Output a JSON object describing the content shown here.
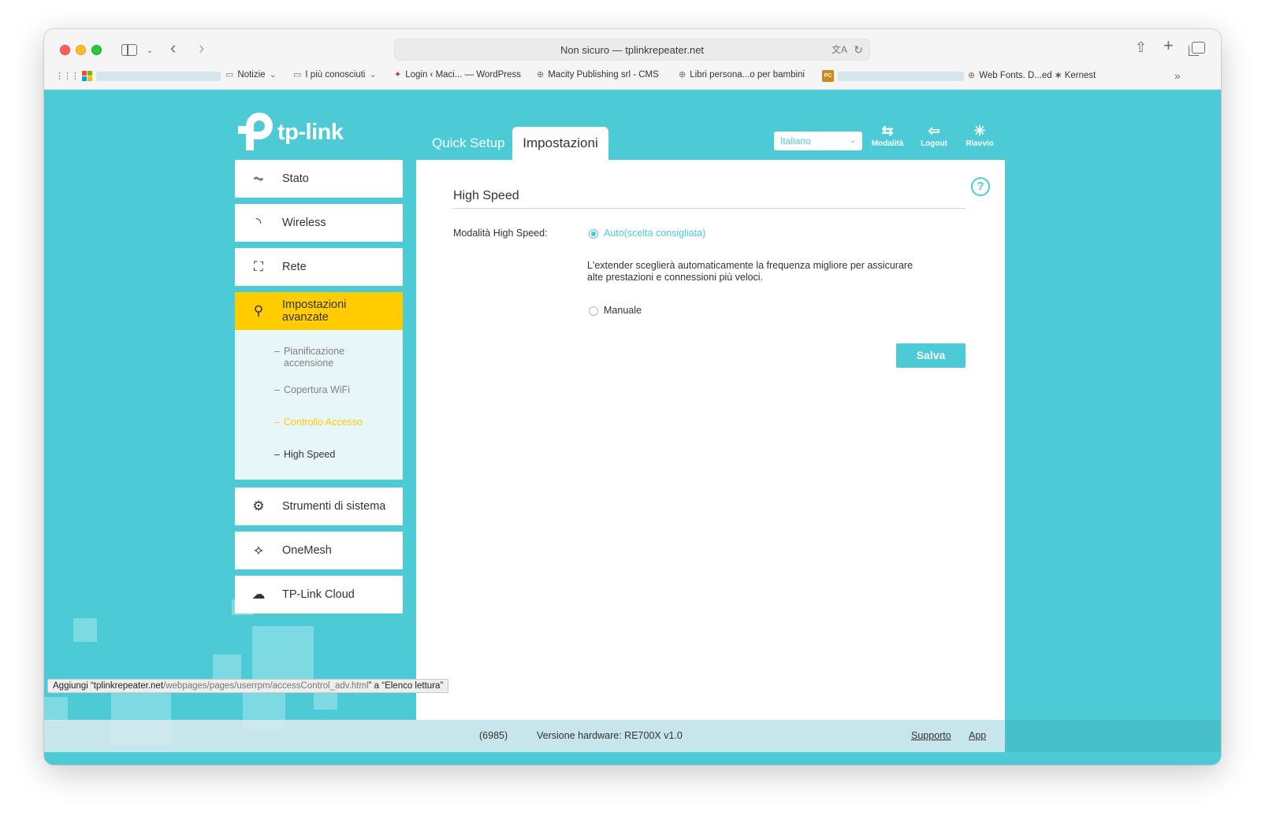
{
  "browser": {
    "address": "Non sicuro — tplinkrepeater.net",
    "bookmarks": [
      {
        "label": "Notizie",
        "icon": "folder-icon",
        "dropdown": true
      },
      {
        "label": "I più conosciuti",
        "icon": "folder-icon",
        "dropdown": true
      },
      {
        "label": "Login ‹ Maci... — WordPress",
        "icon": "wordpress-icon"
      },
      {
        "label": "Macity Publishing srl - CMS",
        "icon": "globe-icon"
      },
      {
        "label": "Libri persona...o per bambini",
        "icon": "globe-icon"
      },
      {
        "label": "Web Fonts. D...ed ∗ Kernest",
        "icon": "globe-icon"
      }
    ],
    "pc_badge": "PC",
    "status_tooltip": {
      "prefix": "Aggiungi “",
      "host": "tplinkrepeater.net",
      "path": "/webpages/pages/userrpm/accessControl_adv.html",
      "suffix": "” a “Elenco lettura”"
    }
  },
  "app": {
    "logo_text": "tp-link",
    "tabs": [
      {
        "label": "Quick Setup",
        "active": false
      },
      {
        "label": "Impostazioni",
        "active": true
      }
    ],
    "language": "Italiano",
    "actions": [
      {
        "label": "Modalità",
        "icon": "mode-switch-icon"
      },
      {
        "label": "Logout",
        "icon": "logout-icon"
      },
      {
        "label": "Riavvio",
        "icon": "reboot-icon"
      }
    ]
  },
  "sidebar": {
    "items": [
      {
        "label": "Stato",
        "icon": "pulse-icon"
      },
      {
        "label": "Wireless",
        "icon": "wifi-icon"
      },
      {
        "label": "Rete",
        "icon": "network-icon"
      },
      {
        "label": "Impostazioni avanzate",
        "icon": "wrench-icon",
        "active": true
      },
      {
        "label": "Strumenti di sistema",
        "icon": "gear-icon"
      },
      {
        "label": "OneMesh",
        "icon": "mesh-icon"
      },
      {
        "label": "TP-Link Cloud",
        "icon": "cloud-icon"
      }
    ],
    "submenu": [
      {
        "label": "Pianificazione accensione"
      },
      {
        "label": "Copertura WiFi"
      },
      {
        "label": "Controllo Accesso",
        "hover": true
      },
      {
        "label": "High Speed",
        "selected": true
      }
    ]
  },
  "content": {
    "title": "High Speed",
    "field_label": "Modalità High Speed:",
    "option_auto": "Auto(scelta consigliata)",
    "description": "L'extender sceglierà automaticamente la frequenza migliore per assicurare alte prestazioni e connessioni più veloci.",
    "option_manual": "Manuale",
    "selected_option": "auto",
    "save_label": "Salva"
  },
  "footer": {
    "firmware_tail": "(6985)",
    "hardware": "Versione hardware: RE700X v1.0",
    "support": "Supporto",
    "app": "App"
  },
  "colors": {
    "brand": "#4ccbd7",
    "active": "#ffcc00"
  }
}
